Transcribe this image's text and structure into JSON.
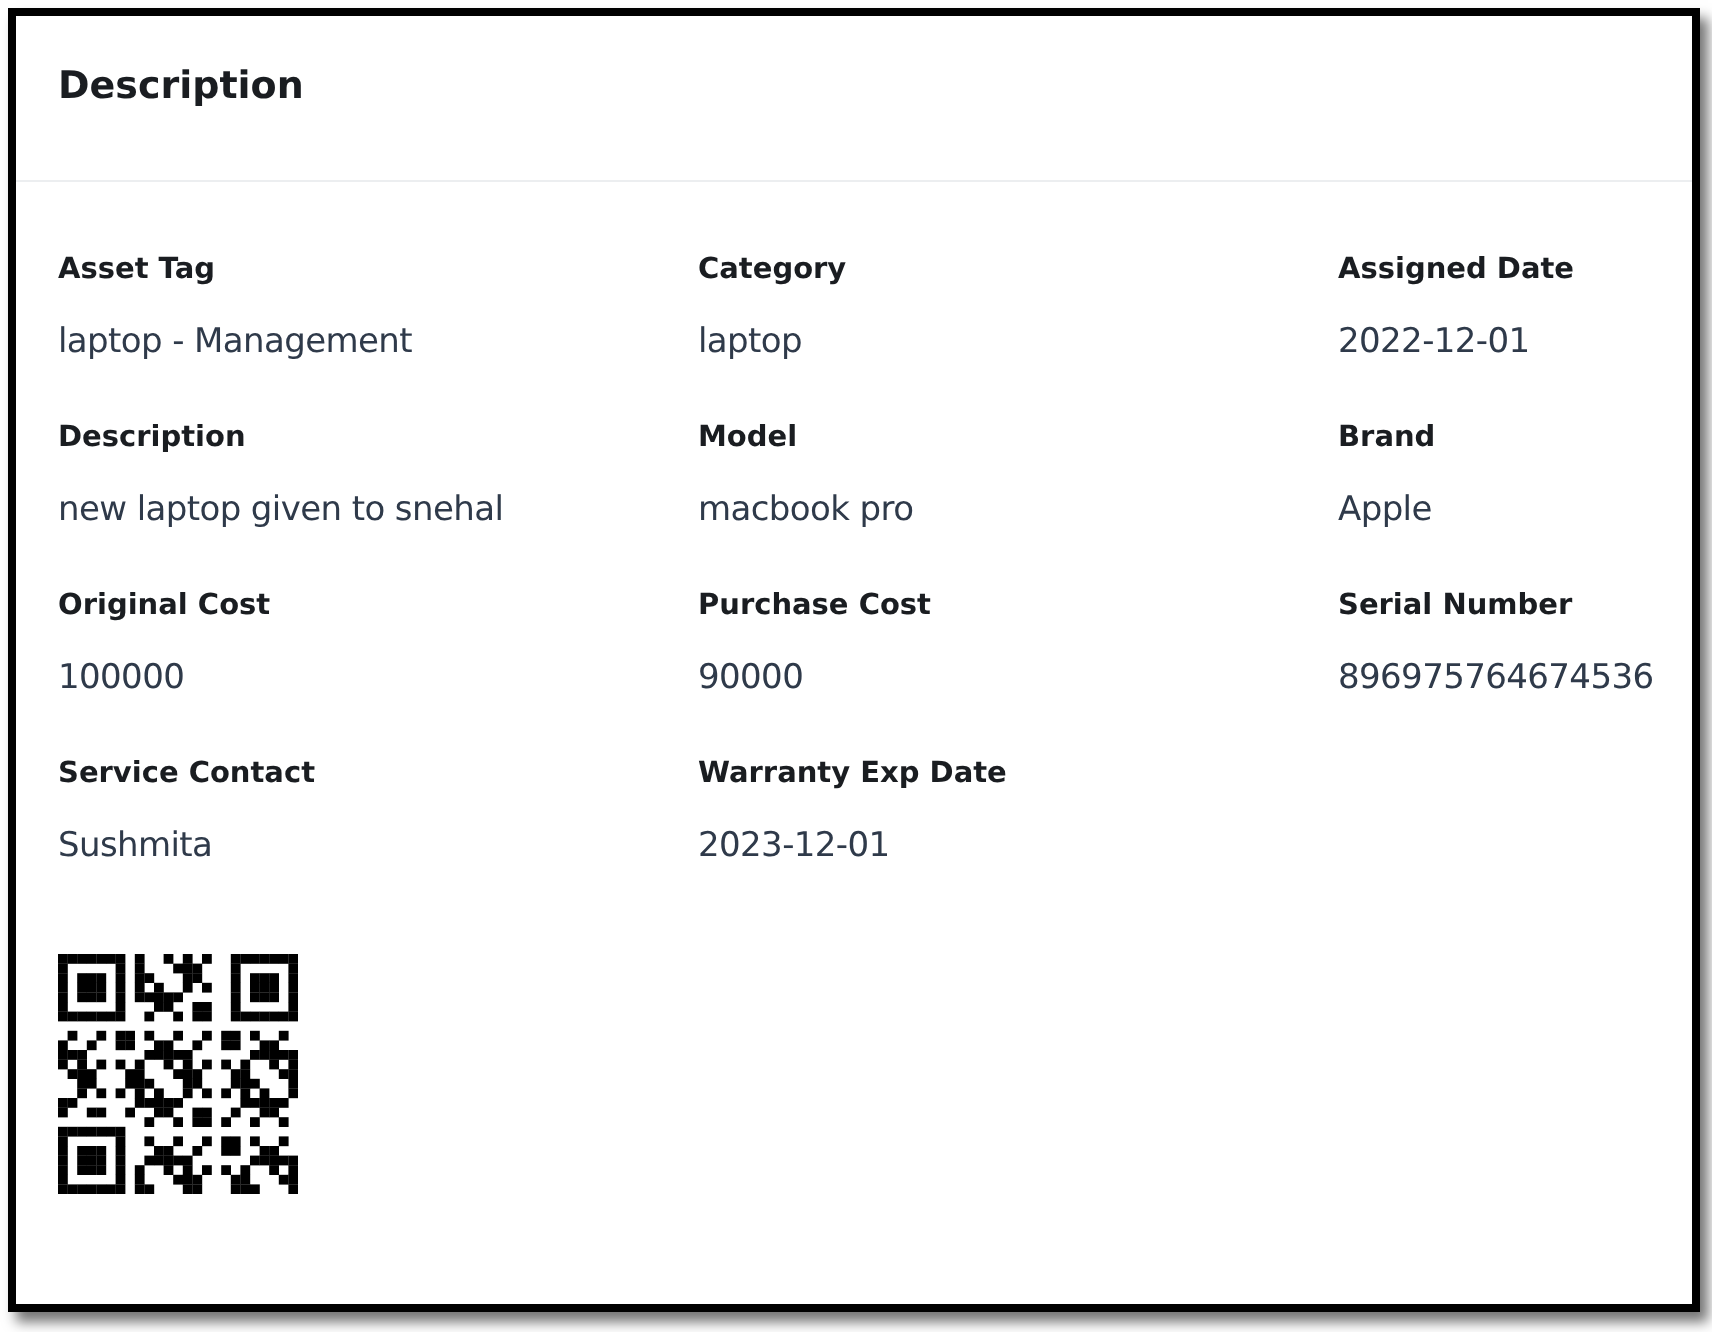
{
  "card": {
    "title": "Description"
  },
  "fields": [
    {
      "label": "Asset Tag",
      "value": "laptop - Management"
    },
    {
      "label": "Category",
      "value": "laptop"
    },
    {
      "label": "Assigned Date",
      "value": "2022-12-01"
    },
    {
      "label": "Description",
      "value": "new laptop given to snehal"
    },
    {
      "label": "Model",
      "value": "macbook pro"
    },
    {
      "label": "Brand",
      "value": "Apple"
    },
    {
      "label": "Original Cost",
      "value": "100000"
    },
    {
      "label": "Purchase Cost",
      "value": "90000"
    },
    {
      "label": "Serial Number",
      "value": "896975764674536"
    },
    {
      "label": "Service Contact",
      "value": "Sushmita"
    },
    {
      "label": "Warranty Exp Date",
      "value": "2023-12-01"
    }
  ]
}
